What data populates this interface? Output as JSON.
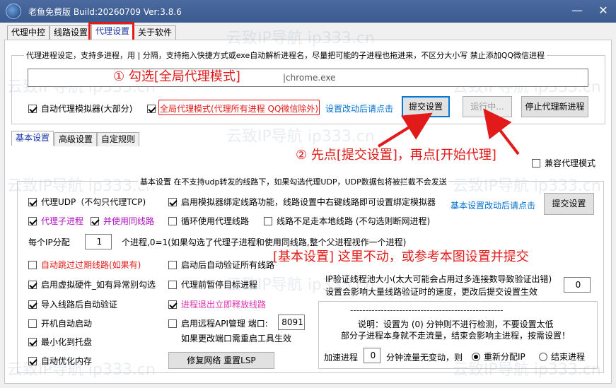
{
  "window": {
    "title": "老鱼免费版 Build:20260709 Ver:3.8.6",
    "minimize": "—",
    "close": "✕"
  },
  "tabs": [
    "代理中控",
    "线路设置",
    "代理设置",
    "关于软件"
  ],
  "watermark": "云致IP导航 ip333.cn",
  "proxy_process": {
    "group_title": "代理进程设定，支持多进程，用 | 分隔，支持拖入快捷方式或exe自动解析进程名，尽量把可能的子进程也拖进来，不区分大小写 禁止添加QQ微信进程",
    "process_value": "|chrome.exe",
    "auto_simulator": "自动代理模拟器(大部分)",
    "global_mode": "全局代理模式(代理所有进程 QQ微信除外)",
    "hint": "设置改动后请点击",
    "submit_button": "提交设置",
    "running_button": "运行中...",
    "stop_button": "停止代理新进程"
  },
  "annotations": {
    "step1": "① 勾选[全局代理模式]",
    "step2": "② 先点[提交设置]，再点[开始代理]",
    "step3": "[基本设置] 这里不动，或参考本图设置并提交"
  },
  "subtabs": [
    "基本设置",
    "高级设置",
    "自定规则"
  ],
  "compat_mode": "兼容代理模式",
  "basic": {
    "group_title": "基本设置 在不支持udp转发的线路下，如果勾选代理UDP，UDP数据包将被拦截不会发送",
    "proxy_udp": "代理UDP（不勾只代理TCP)",
    "sim_bind": "启用模拟器绑定线路功能，线路设置中右键线路即可设置绑定模拟器",
    "hint": "基本设置改动后请点击",
    "submit_button": "提交设置",
    "proxy_child": "代理子进程",
    "same_line": "并使用同线路",
    "loop_proxy": "循环使用代理线路",
    "no_local": "线路不足走本地线路 (不勾选则断网进程)",
    "ip_alloc_label": "每个IP分配",
    "ip_alloc_value": "1",
    "ip_alloc_desc": "个进程,0=1(如果勾选了代理子进程和使用同线路,整个父进程视作一个进程)",
    "skip_expired": "自动跳过过期线路(如果有)",
    "verify_on_start": "启动后自动验证所有线路",
    "virtual_hw": "启用虚拟硬件_如有异常别勾选",
    "pause_target": "代理前暂停目标进程",
    "auto_verify_import": "导入线路后自动验证",
    "release_on_exit": "进程退出立即释放线路",
    "auto_start": "开机自动启动",
    "remote_api": "启用远程API管理 端口:",
    "port_value": "8091",
    "port_note": "如果更改端口需重启工具生效",
    "min_tray": "最小化到托盘",
    "auto_optimize": "自动优化内存",
    "repair_button": "修复网络 重置LSP",
    "pool_line1": "IP验证线程池大小(太大可能会占用过多连接数导致验证出错)",
    "pool_line2": "设置会影响大量线路验证时的速度，更改后提交设置生效",
    "pool_value": "0",
    "dashes": "--------------------------------------------------",
    "note1": "说明：设置为 (0) 分钟则不进行检测，不要设置太低",
    "note2": "部分子进程本身就不走流量，结束会影响主进程，按需设置！",
    "accel_label": "加速进程",
    "accel_value": "0",
    "accel_desc": "分钟流量无变动，则",
    "radio_realloc": "重新分配IP",
    "radio_end": "结束进程"
  }
}
